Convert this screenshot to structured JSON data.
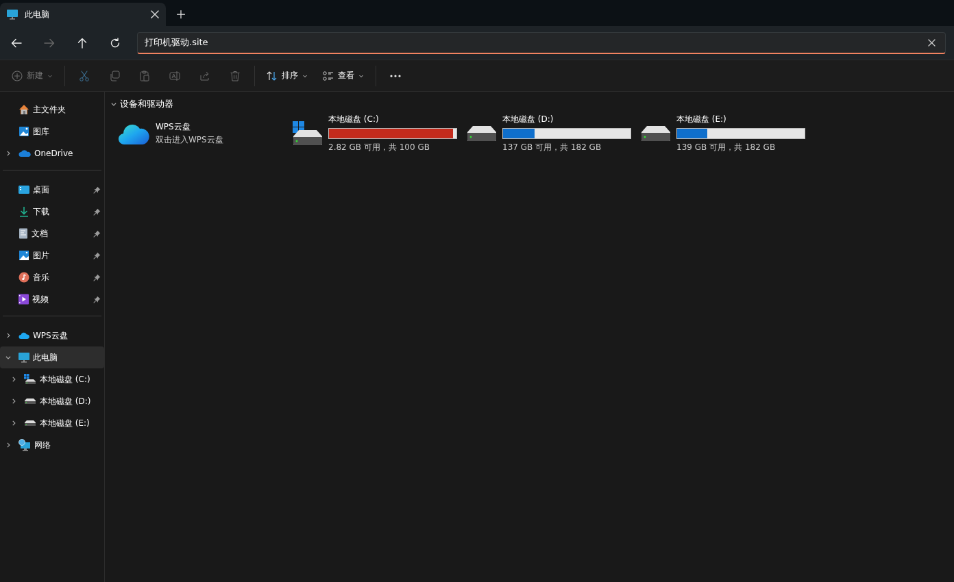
{
  "tabs": [
    {
      "title": "此电脑",
      "selected": true
    }
  ],
  "nav": [
    {
      "kind": "back",
      "disabled": false
    },
    {
      "kind": "forward",
      "disabled": true
    },
    {
      "kind": "up",
      "disabled": false
    },
    {
      "kind": "refresh",
      "disabled": false
    }
  ],
  "address": {
    "value": "打印机驱动.site"
  },
  "toolbar": [
    {
      "kind": "new",
      "label": "新建",
      "disabled": true
    },
    {
      "kind": "sep"
    },
    {
      "kind": "cut",
      "disabled": true
    },
    {
      "kind": "copy",
      "disabled": true
    },
    {
      "kind": "paste",
      "disabled": true
    },
    {
      "kind": "rename",
      "disabled": true
    },
    {
      "kind": "share",
      "disabled": true
    },
    {
      "kind": "delete",
      "disabled": true
    },
    {
      "kind": "sep"
    },
    {
      "kind": "sort",
      "label": "排序",
      "disabled": false
    },
    {
      "kind": "view",
      "label": "查看",
      "disabled": false
    },
    {
      "kind": "sep"
    },
    {
      "kind": "more"
    }
  ],
  "sidebar": [
    [
      {
        "label": "主文件夹",
        "selected": false
      },
      {
        "label": "图库",
        "selected": false
      },
      {
        "label": "OneDrive",
        "expanded": false,
        "selected": false
      }
    ],
    [
      {
        "label": "桌面",
        "pinned": true,
        "selected": false
      },
      {
        "label": "下载",
        "pinned": true,
        "selected": false
      },
      {
        "label": "文档",
        "pinned": true,
        "selected": false
      },
      {
        "label": "图片",
        "pinned": true,
        "selected": false
      },
      {
        "label": "音乐",
        "pinned": true,
        "selected": false
      },
      {
        "label": "视频",
        "pinned": true,
        "selected": false
      }
    ],
    [
      {
        "label": "WPS云盘",
        "expanded": false,
        "selected": false
      },
      {
        "label": "此电脑",
        "expanded": true,
        "selected": true,
        "children": [
          {
            "label": "本地磁盘 (C:)",
            "expanded": false,
            "selected": false
          },
          {
            "label": "本地磁盘 (D:)",
            "expanded": false,
            "selected": false
          },
          {
            "label": "本地磁盘 (E:)",
            "expanded": false,
            "selected": false
          }
        ]
      },
      {
        "label": "网络",
        "expanded": false,
        "selected": false
      }
    ]
  ],
  "section": {
    "title": "设备和驱动器",
    "expanded": true
  },
  "items": [
    {
      "kind": "cloud",
      "name": "WPS云盘",
      "subtitle": "双击进入WPS云盘"
    },
    {
      "kind": "drive",
      "system": true,
      "name": "本地磁盘 (C:)",
      "level": 0.972,
      "low_space": true,
      "subtitle": "2.82 GB 可用，共 100 GB"
    },
    {
      "kind": "drive",
      "system": false,
      "name": "本地磁盘 (D:)",
      "level": 0.247,
      "low_space": false,
      "subtitle": "137 GB 可用，共 182 GB"
    },
    {
      "kind": "drive",
      "system": false,
      "name": "本地磁盘 (E:)",
      "level": 0.236,
      "low_space": false,
      "subtitle": "139 GB 可用，共 182 GB"
    }
  ]
}
